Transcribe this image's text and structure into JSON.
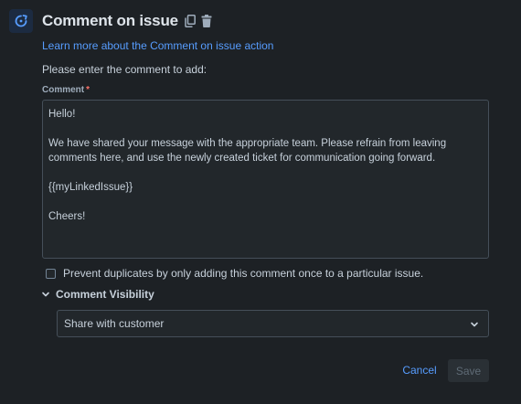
{
  "header": {
    "title": "Comment on issue",
    "action_icon": "comment-action-icon",
    "copy_icon": "copy-icon",
    "delete_icon": "trash-icon"
  },
  "learn_more_link": "Learn more about the Comment on issue action",
  "prompt": "Please enter the comment to add:",
  "comment_field": {
    "label": "Comment",
    "required_marker": "*",
    "value": "Hello!\n\nWe have shared your message with the appropriate team. Please refrain from leaving comments here, and use the newly created ticket for communication going forward.\n\n{{myLinkedIssue}}\n\nCheers!"
  },
  "prevent_duplicates": {
    "label": "Prevent duplicates by only adding this comment once to a particular issue.",
    "checked": false
  },
  "visibility": {
    "section_label": "Comment Visibility",
    "expanded": true,
    "selected": "Share with customer"
  },
  "buttons": {
    "cancel": "Cancel",
    "save": "Save"
  },
  "colors": {
    "background": "#1d2125",
    "link": "#579dff",
    "required": "#f87168"
  }
}
